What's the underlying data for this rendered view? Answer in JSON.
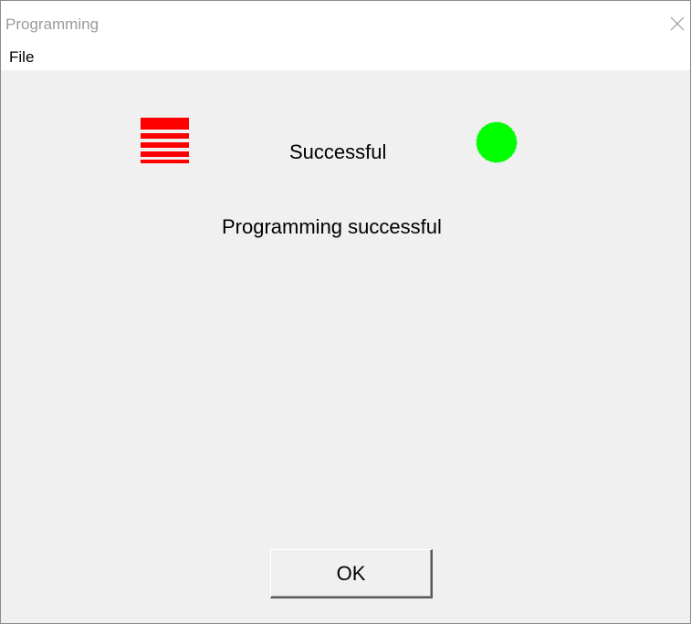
{
  "window": {
    "title": "Programming"
  },
  "menu": {
    "items": [
      {
        "label": "File"
      }
    ]
  },
  "status": {
    "left_icon": "red-stacked-bars-icon",
    "left_icon_color": "#ff0000",
    "text": "Successful",
    "indicator_icon": "status-light-icon",
    "indicator_color": "#00ff00"
  },
  "message": {
    "text": "Programming successful"
  },
  "buttons": {
    "ok_label": "OK"
  }
}
